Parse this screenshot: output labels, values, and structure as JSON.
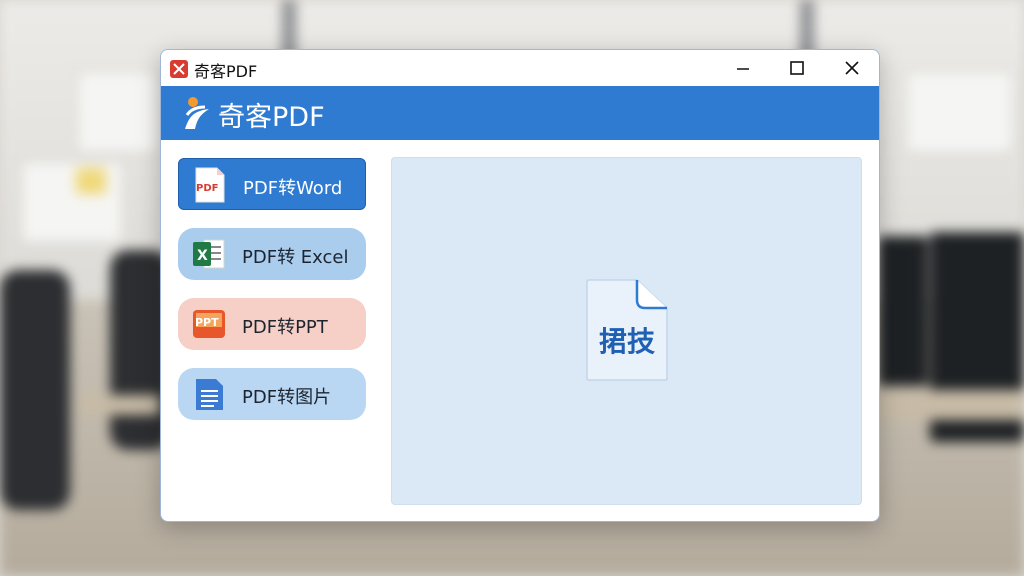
{
  "window": {
    "title": "奇客PDF",
    "app_icon": "pdf-app-icon",
    "controls": [
      "minimize-icon",
      "maximize-icon",
      "close-icon"
    ]
  },
  "banner": {
    "brand_name": "奇客PDF",
    "logo": "brand-logo",
    "color": "#2f7bd2"
  },
  "sidebar": {
    "items": [
      {
        "label": "PDF转Word",
        "icon": "pdf-icon",
        "selected": true
      },
      {
        "label": "PDF转 Excel",
        "icon": "excel-icon",
        "selected": false
      },
      {
        "label": "PDF转PPT",
        "icon": "ppt-icon",
        "selected": false
      },
      {
        "label": "PDF转图片",
        "icon": "image-doc-icon",
        "selected": false
      }
    ]
  },
  "main": {
    "file_card_text": "捃技",
    "file_icon": "document-icon"
  }
}
